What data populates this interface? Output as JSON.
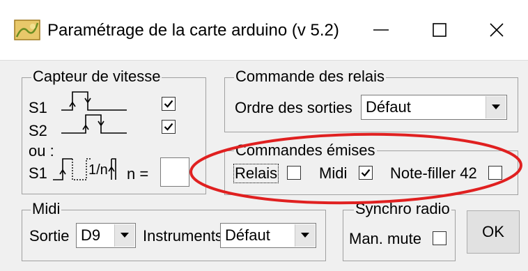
{
  "window": {
    "title": "Paramétrage de la carte arduino (v 5.2)",
    "minimize_glyph": "—",
    "maximize_glyph": "☐",
    "close_glyph": "✕"
  },
  "speed_sensor": {
    "legend": "Capteur de vitesse",
    "s1_label": "S1",
    "s2_label": "S2",
    "or_label": "ou :",
    "s1_alt_label": "S1",
    "one_over_n": "1/n",
    "n_label": "n =",
    "n_value": "",
    "s1_checked": true,
    "s2_checked": true
  },
  "relay_command": {
    "legend": "Commande des relais",
    "order_label": "Ordre des sorties",
    "order_value": "Défaut"
  },
  "emitted_commands": {
    "legend": "Commandes émises",
    "relais_label": "Relais",
    "relais_checked": false,
    "midi_label": "Midi",
    "midi_checked": true,
    "notefiller_label": "Note-filler 42",
    "notefiller_checked": false
  },
  "midi": {
    "legend": "Midi",
    "output_label": "Sortie",
    "output_value": "D9",
    "instruments_label": "Instruments",
    "instruments_value": "Défaut"
  },
  "synchro_radio": {
    "legend": "Synchro radio",
    "man_mute_label": "Man. mute",
    "man_mute_checked": false
  },
  "ok_button": {
    "label": "OK"
  },
  "colors": {
    "dialog_bg": "#f0f0f0",
    "annotation": "#e02020",
    "group_border": "#a0a0a0"
  }
}
